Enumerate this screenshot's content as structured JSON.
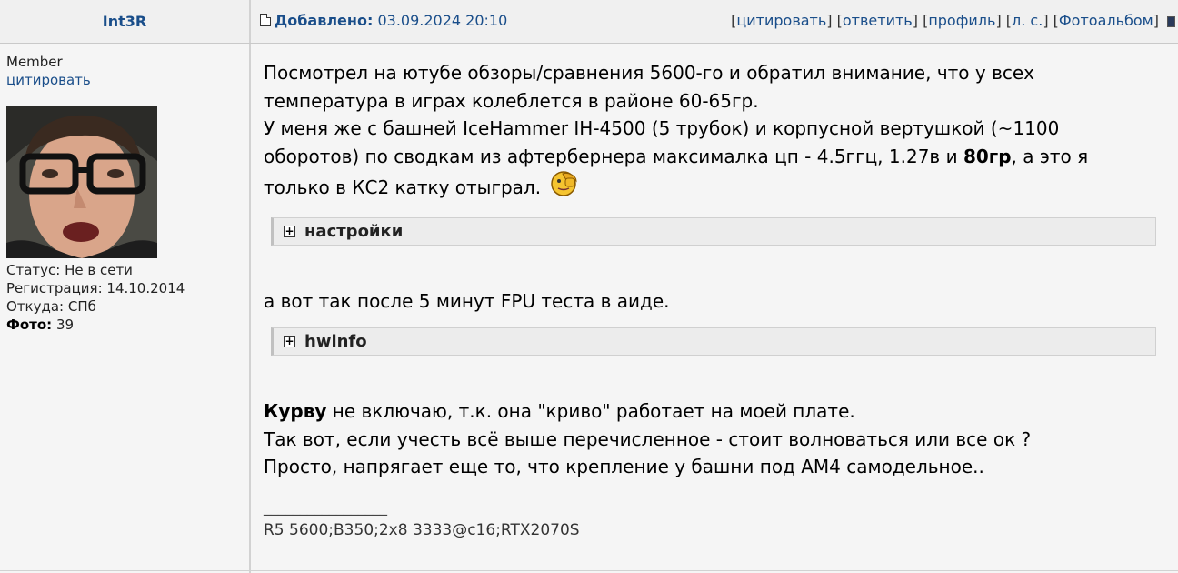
{
  "header": {
    "username": "Int3R",
    "added_label": "Добавлено:",
    "added_datetime": "03.09.2024 20:10",
    "actions": [
      "цитировать",
      "ответить",
      "профиль",
      "л. с.",
      "Фотоальбом"
    ]
  },
  "profile": {
    "rank": "Member",
    "quote_link": "цитировать",
    "status": "Статус: Не в сети",
    "registration": "Регистрация: 14.10.2014",
    "location": "Откуда: СПб",
    "photo_label": "Фото:",
    "photo_count": "39"
  },
  "post": {
    "p1_line1": "Посмотрел на ютубе обзоры/сравнения 5600-го и обратил внимание, что у всех",
    "p1_line2": "температура в играх колеблется в районе 60-65гр.",
    "p1_line3": "У меня же с башней IceHammer IH-4500 (5 трубок) и корпусной вертушкой (~1100",
    "p1_line4a": "оборотов) по сводкам из афтербернера максималка цп - 4.5ггц, 1.27в и",
    "p1_bold": "80гр",
    "p1_line4b": ", а это я",
    "p1_line5": "только в КС2 катку отыграл.",
    "spoiler1": "настройки",
    "p2": "а вот так после 5 минут FPU теста в аиде.",
    "spoiler2": "hwinfo",
    "p3_bold": "Курву",
    "p3_line1": " не включаю, т.к. она \"криво\" работает на моей плате.",
    "p3_line2": "Так вот, если учесть всё выше перечисленное - стоит волноваться или все ок ?",
    "p3_line3": "Просто, напрягает еще то, что крепление у башни под АМ4 самодельное..",
    "signature_sep": "_________________",
    "signature": "R5 5600;B350;2x8 3333@c16;RTX2070S"
  },
  "colors": {
    "link": "#1a4e8a",
    "background": "#f5f5f5",
    "header_bg": "#f0f0f0"
  }
}
